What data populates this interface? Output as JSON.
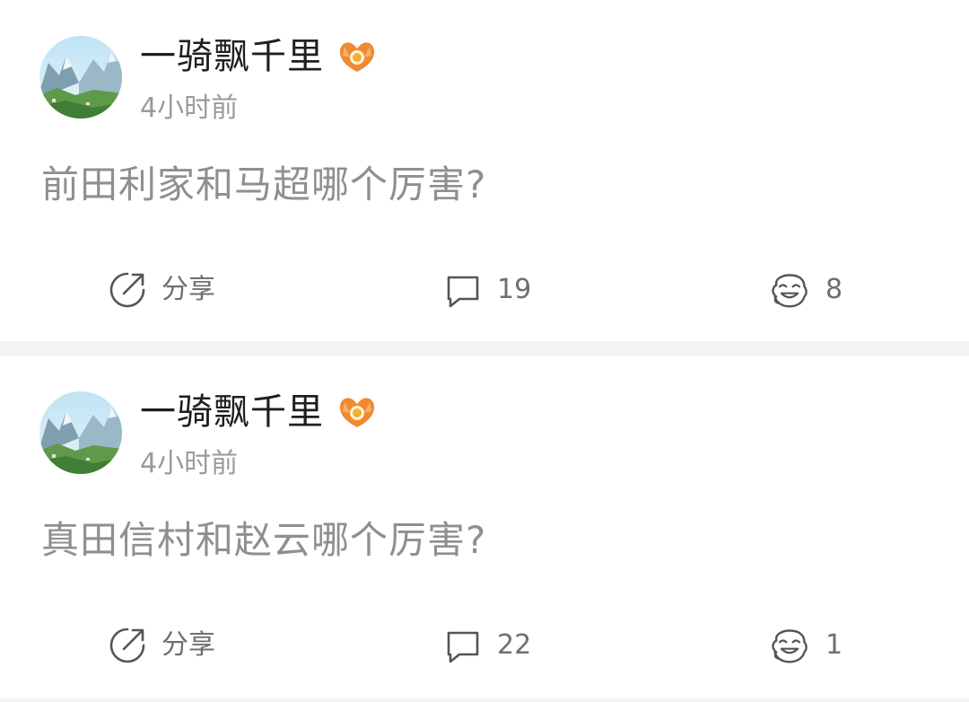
{
  "posts": [
    {
      "username": "一骑飘千里",
      "badge_icon": "orange-fan-badge-icon",
      "timestamp": "4小时前",
      "content": "前田利家和马超哪个厉害?",
      "share_label": "分享",
      "comment_count": "19",
      "reaction_count": "8"
    },
    {
      "username": "一骑飘千里",
      "badge_icon": "orange-fan-badge-icon",
      "timestamp": "4小时前",
      "content": "真田信村和赵云哪个厉害?",
      "share_label": "分享",
      "comment_count": "22",
      "reaction_count": "1"
    }
  ],
  "colors": {
    "username": "#1f1f1f",
    "timestamp": "#9a9a9a",
    "content": "#8f8f8f",
    "action_text": "#6f6f6f",
    "divider": "#f3f3f4",
    "badge": "#f08a32"
  }
}
